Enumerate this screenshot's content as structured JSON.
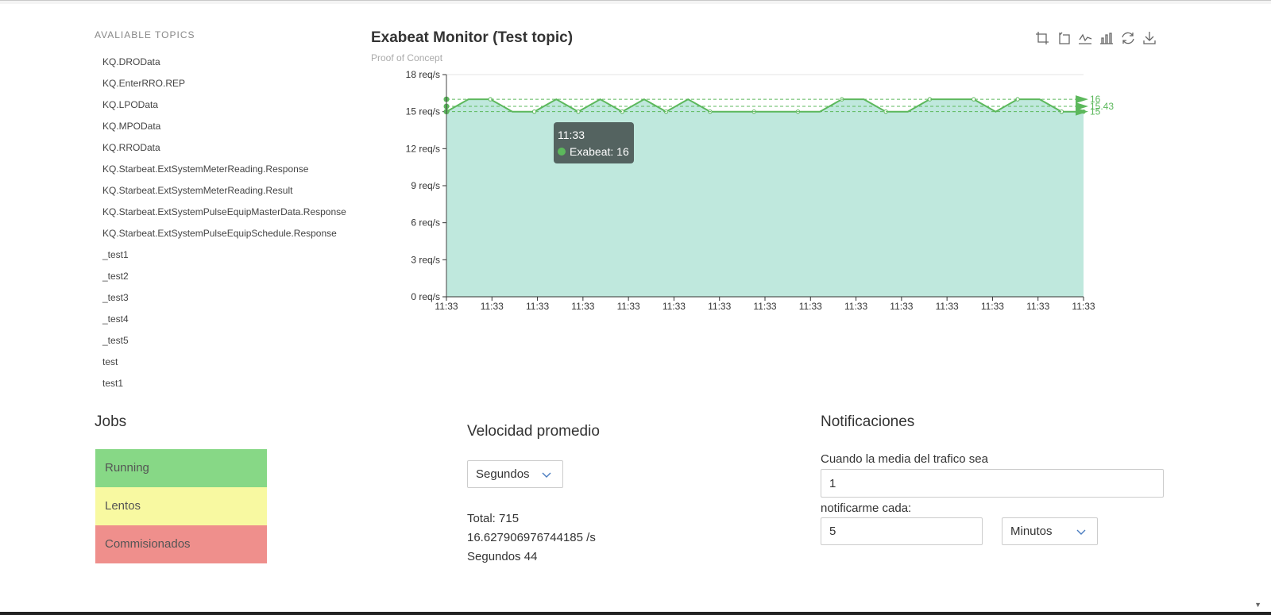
{
  "sidebar": {
    "title": "AVALIABLE TOPICS",
    "topics": [
      "KQ.DROData",
      "KQ.EnterRRO.REP",
      "KQ.LPOData",
      "KQ.MPOData",
      "KQ.RROData",
      "KQ.Starbeat.ExtSystemMeterReading.Response",
      "KQ.Starbeat.ExtSystemMeterReading.Result",
      "KQ.Starbeat.ExtSystemPulseEquipMasterData.Response",
      "KQ.Starbeat.ExtSystemPulseEquipSchedule.Response",
      "_test1",
      "_test2",
      "_test3",
      "_test4",
      "_test5",
      "test",
      "test1"
    ]
  },
  "monitor": {
    "title": "Exabeat Monitor (Test topic)",
    "subtitle": "Proof of Concept",
    "toolbox_icons": [
      "zoom-icon",
      "zoom-reset-icon",
      "line-chart-icon",
      "bar-chart-icon",
      "restore-icon",
      "download-icon"
    ],
    "tooltip": {
      "time": "11:33",
      "series_label": "Exabeat: 16"
    }
  },
  "chart_data": {
    "type": "area",
    "title": "Exabeat Monitor (Test topic)",
    "subtitle": "Proof of Concept",
    "x": [
      "11:33",
      "11:33",
      "11:33",
      "11:33",
      "11:33",
      "11:33",
      "11:33",
      "11:33",
      "11:33",
      "11:33",
      "11:33",
      "11:33",
      "11:33",
      "11:33",
      "11:33",
      "11:33",
      "11:33",
      "11:33",
      "11:33",
      "11:33",
      "11:33",
      "11:33",
      "11:33",
      "11:33",
      "11:33",
      "11:33",
      "11:33",
      "11:33",
      "11:33",
      "11:33"
    ],
    "x_tick_labels": [
      "11:33",
      "11:33",
      "11:33",
      "11:33",
      "11:33",
      "11:33",
      "11:33",
      "11:33",
      "11:33",
      "11:33",
      "11:33",
      "11:33",
      "11:33",
      "11:33",
      "11:33"
    ],
    "series": [
      {
        "name": "Exabeat",
        "values": [
          15,
          16,
          16,
          15,
          15,
          16,
          15,
          16,
          15,
          16,
          15,
          16,
          15,
          15,
          15,
          15,
          15,
          15,
          16,
          16,
          15,
          15,
          16,
          16,
          16,
          15,
          16,
          16,
          15,
          15
        ],
        "color": "#5cb85c",
        "area_color": "#bfe8dd"
      }
    ],
    "y_ticks": [
      "0 req/s",
      "3 req/s",
      "6 req/s",
      "9 req/s",
      "12 req/s",
      "15 req/s",
      "18 req/s"
    ],
    "ylim": [
      0,
      18
    ],
    "mark_lines": [
      {
        "label": "16",
        "value": 16
      },
      {
        "label": "15.43",
        "value": 15.43
      },
      {
        "label": "15",
        "value": 15
      }
    ],
    "grid": true
  },
  "jobs": {
    "title": "Jobs",
    "items": [
      {
        "label": "Running",
        "color": "#87d886"
      },
      {
        "label": "Lentos",
        "color": "#f8f9a1"
      },
      {
        "label": "Commisionados",
        "color": "#ef8f8c"
      }
    ]
  },
  "velocity": {
    "title": "Velocidad promedio",
    "unit_select": "Segundos",
    "total": "Total: 715",
    "rate": "16.627906976744185 /s",
    "seconds": "Segundos 44"
  },
  "notifications": {
    "title": "Notificaciones",
    "label_threshold": "Cuando la media del trafico sea",
    "threshold_value": "1",
    "label_every": "notificarme cada:",
    "every_value": "5",
    "every_unit": "Minutos"
  }
}
